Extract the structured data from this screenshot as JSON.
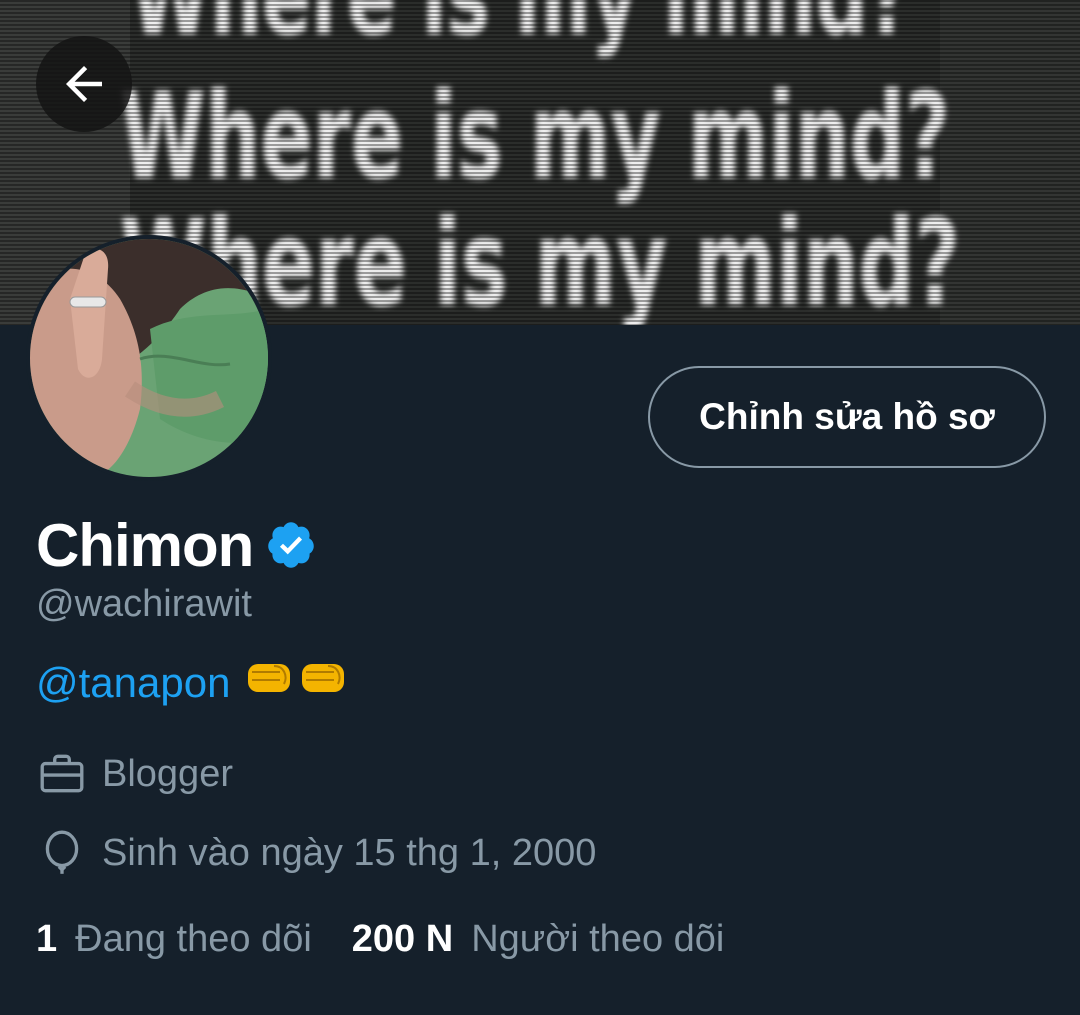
{
  "profile": {
    "display_name": "Chimon",
    "verified": true,
    "handle": "@wachirawit",
    "bio_mention": "@tanapon",
    "bio_emoji": [
      "fist-emoji",
      "fist-emoji"
    ],
    "occupation": "Blogger",
    "birthday": "Sinh vào ngày 15 thg 1, 2000"
  },
  "header": {
    "back_icon": "arrow-left-icon",
    "banner_text": [
      "Where is my mind?",
      "Where is my mind?",
      "Where is my mind?"
    ]
  },
  "actions": {
    "edit_profile_label": "Chỉnh sửa hồ sơ"
  },
  "stats": {
    "following_count": "1",
    "following_label": "Đang theo dõi",
    "followers_count": "200 N",
    "followers_label": "Người theo dõi"
  },
  "colors": {
    "background": "#15202b",
    "accent": "#1da1f2",
    "secondary_text": "#8899a6",
    "primary_text": "#ffffff"
  }
}
